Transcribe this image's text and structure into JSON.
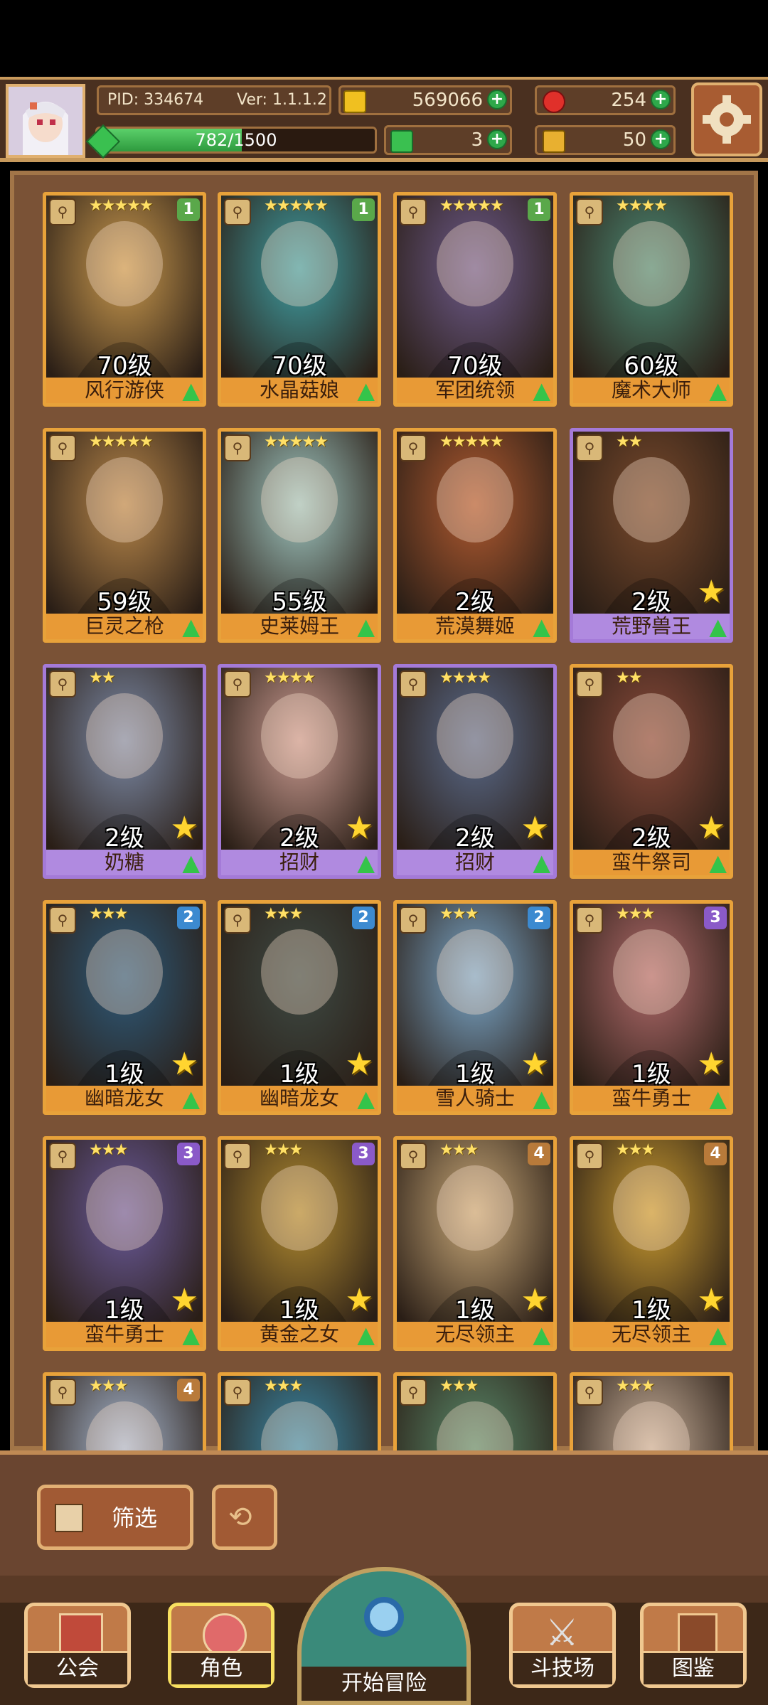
{
  "header": {
    "pid": "PID: 334674",
    "version": "Ver: 1.1.1.2",
    "gold": "569066",
    "gems": "254",
    "xp": "782/1500",
    "xp_progress": 0.521,
    "clovers": "3",
    "keys": "50"
  },
  "colors": {
    "frame_gold": "#e8a23a",
    "frame_purple": "#a47ad8",
    "star": "#ffd530",
    "upgrade_green": "#34c44a",
    "rank_green": "#5aa84a",
    "rank_blue": "#3c8ad0",
    "rank_purple": "#8a5ac8"
  },
  "cards": [
    {
      "name": "风行游侠",
      "level": "70级",
      "stars": "★★★★★",
      "rank": "1",
      "rank_color": "#5aa84a",
      "frame": "gold",
      "art": "#c9994e",
      "star_badge": false
    },
    {
      "name": "水晶菇娘",
      "level": "70级",
      "stars": "★★★★★",
      "rank": "1",
      "rank_color": "#5aa84a",
      "frame": "gold",
      "art": "#3f9ea2",
      "star_badge": false
    },
    {
      "name": "军团统领",
      "level": "70级",
      "stars": "★★★★★",
      "rank": "1",
      "rank_color": "#5aa84a",
      "frame": "gold",
      "art": "#6d5a8a",
      "star_badge": false
    },
    {
      "name": "魔术大师",
      "level": "60级",
      "stars": "★★★★",
      "rank": "",
      "rank_color": "",
      "frame": "gold",
      "art": "#4c8a74",
      "star_badge": false
    },
    {
      "name": "巨灵之枪",
      "level": "59级",
      "stars": "★★★★★",
      "rank": "",
      "rank_color": "",
      "frame": "gold",
      "art": "#b8874a",
      "star_badge": false
    },
    {
      "name": "史莱姆王",
      "level": "55级",
      "stars": "★★★★★",
      "rank": "",
      "rank_color": "",
      "frame": "gold",
      "art": "#9fc6c0",
      "star_badge": false
    },
    {
      "name": "荒漠舞姬",
      "level": "2级",
      "stars": "★★★★★",
      "rank": "",
      "rank_color": "",
      "frame": "gold",
      "art": "#b05a30",
      "star_badge": false
    },
    {
      "name": "荒野兽王",
      "level": "2级",
      "stars": "★★",
      "rank": "",
      "rank_color": "",
      "frame": "purple",
      "art": "#7a4a2c",
      "star_badge": true
    },
    {
      "name": "奶糖",
      "level": "2级",
      "stars": "★★",
      "rank": "",
      "rank_color": "",
      "frame": "purple",
      "art": "#7c8aa6",
      "star_badge": true
    },
    {
      "name": "招财",
      "level": "2级",
      "stars": "★★★★",
      "rank": "",
      "rank_color": "",
      "frame": "purple",
      "art": "#c99a90",
      "star_badge": true
    },
    {
      "name": "招财",
      "level": "2级",
      "stars": "★★★★",
      "rank": "",
      "rank_color": "",
      "frame": "purple",
      "art": "#5a6a8a",
      "star_badge": true
    },
    {
      "name": "蛮牛祭司",
      "level": "2级",
      "stars": "★★",
      "rank": "",
      "rank_color": "",
      "frame": "gold",
      "art": "#8a4a3a",
      "star_badge": true
    },
    {
      "name": "幽暗龙女",
      "level": "1级",
      "stars": "★★★",
      "rank": "2",
      "rank_color": "#3c8ad0",
      "frame": "gold",
      "art": "#2e5a7a",
      "star_badge": true
    },
    {
      "name": "幽暗龙女",
      "level": "1级",
      "stars": "★★★",
      "rank": "2",
      "rank_color": "#3c8ad0",
      "frame": "gold",
      "art": "#3e4a44",
      "star_badge": true
    },
    {
      "name": "雪人骑士",
      "level": "1级",
      "stars": "★★★",
      "rank": "2",
      "rank_color": "#3c8ad0",
      "frame": "gold",
      "art": "#7aa6c8",
      "star_badge": true
    },
    {
      "name": "蛮牛勇士",
      "level": "1级",
      "stars": "★★★",
      "rank": "3",
      "rank_color": "#8a5ac8",
      "frame": "gold",
      "art": "#b06a6a",
      "star_badge": true
    },
    {
      "name": "蛮牛勇士",
      "level": "1级",
      "stars": "★★★",
      "rank": "3",
      "rank_color": "#8a5ac8",
      "frame": "gold",
      "art": "#6a5a9a",
      "star_badge": true
    },
    {
      "name": "黄金之女",
      "level": "1级",
      "stars": "★★★",
      "rank": "3",
      "rank_color": "#8a5ac8",
      "frame": "gold",
      "art": "#b08a30",
      "star_badge": true
    },
    {
      "name": "无尽领主",
      "level": "1级",
      "stars": "★★★",
      "rank": "4",
      "rank_color": "#b87a3a",
      "frame": "gold",
      "art": "#c8a878",
      "star_badge": true
    },
    {
      "name": "无尽领主",
      "level": "1级",
      "stars": "★★★",
      "rank": "4",
      "rank_color": "#b87a3a",
      "frame": "gold",
      "art": "#c89a30",
      "star_badge": true
    },
    {
      "name": "",
      "level": "",
      "stars": "★★★",
      "rank": "4",
      "rank_color": "#b87a3a",
      "frame": "gold",
      "art": "#a8b8d0",
      "star_badge": false
    },
    {
      "name": "",
      "level": "",
      "stars": "★★★",
      "rank": "",
      "rank_color": "",
      "frame": "gold",
      "art": "#3a8aa8",
      "star_badge": false
    },
    {
      "name": "",
      "level": "",
      "stars": "★★★",
      "rank": "",
      "rank_color": "",
      "frame": "gold",
      "art": "#5a8a6a",
      "star_badge": false
    },
    {
      "name": "",
      "level": "",
      "stars": "★★★",
      "rank": "",
      "rank_color": "",
      "frame": "gold",
      "art": "#c8b09a",
      "star_badge": false
    }
  ],
  "filter": {
    "label": "筛选"
  },
  "nav": [
    {
      "label": "公会",
      "icon": "guild-icon"
    },
    {
      "label": "角色",
      "icon": "character-icon"
    },
    {
      "label": "开始冒险",
      "icon": "adventure-icon"
    },
    {
      "label": "斗技场",
      "icon": "arena-icon"
    },
    {
      "label": "图鉴",
      "icon": "codex-icon"
    }
  ]
}
